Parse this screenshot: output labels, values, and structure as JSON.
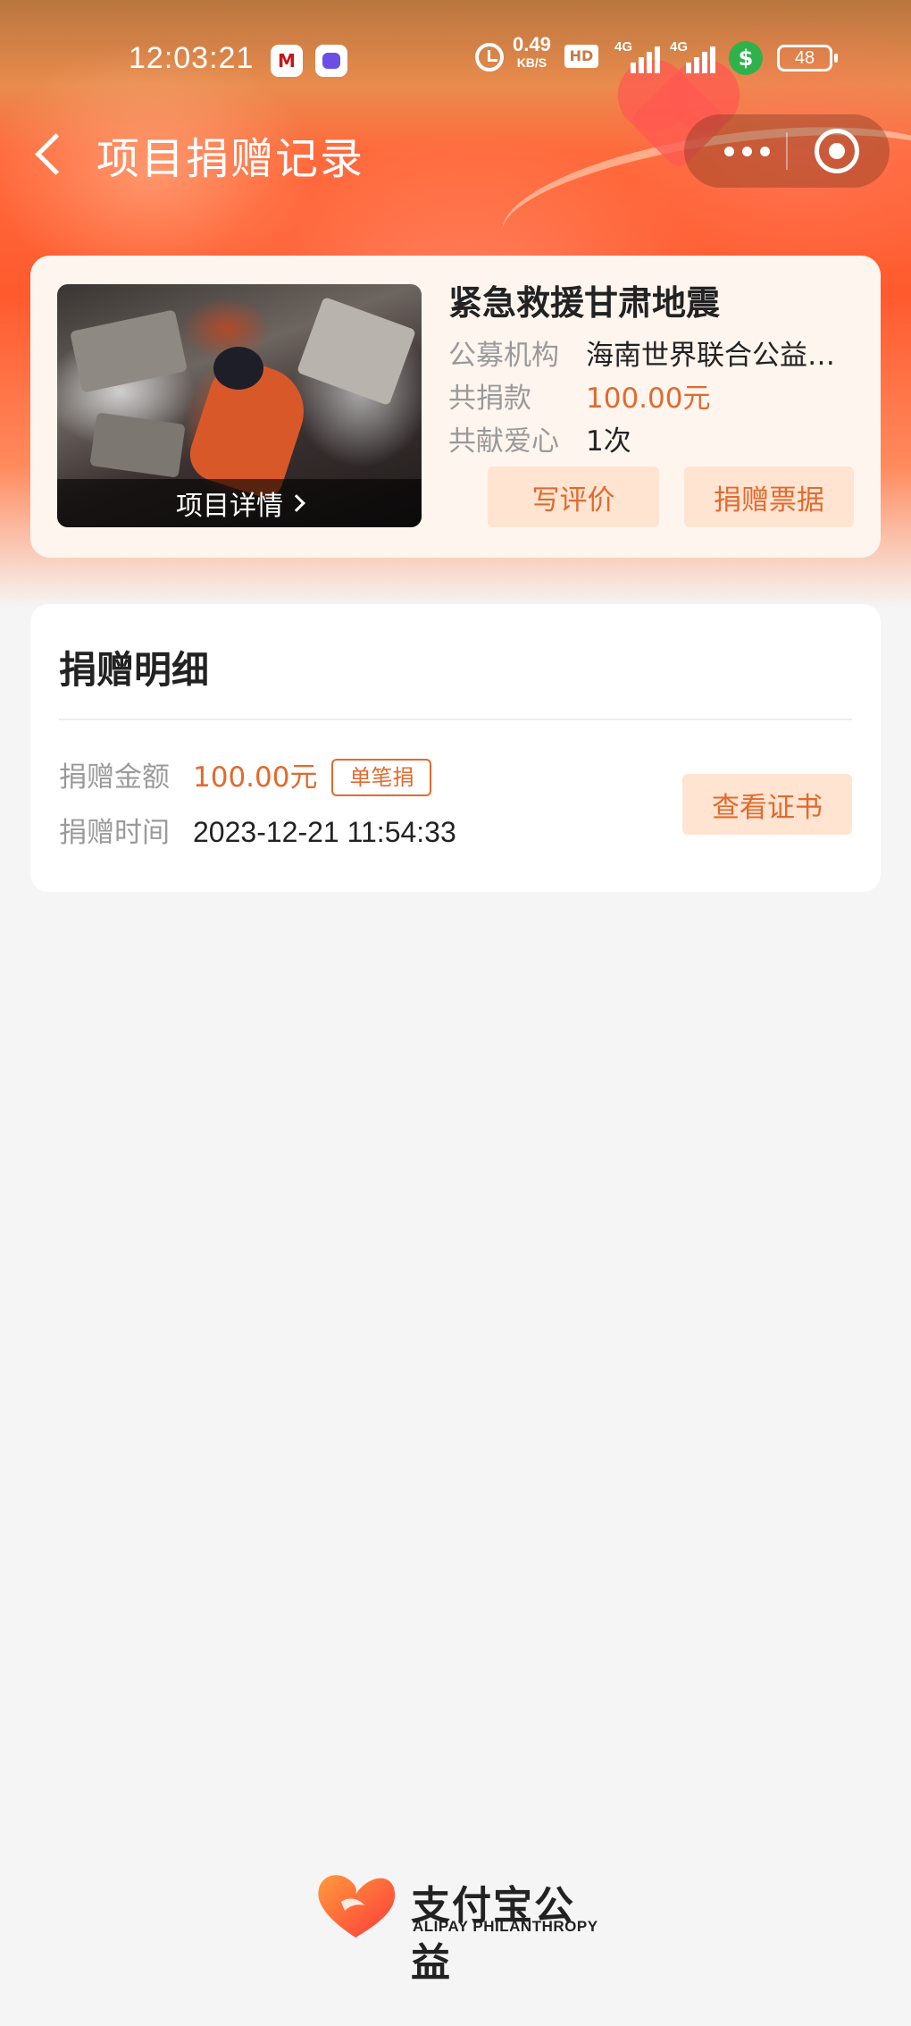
{
  "status_bar": {
    "time": "12:03:21",
    "cmb_icon": "M",
    "net_speed_value": "0.49",
    "net_speed_unit": "KB/S",
    "hd_label": "HD",
    "signal_1": "4G",
    "signal_2": "4G",
    "pay_icon": "$",
    "battery": "48"
  },
  "nav": {
    "title": "项目捐赠记录"
  },
  "project": {
    "title": "紧急救援甘肃地震",
    "image_caption": "项目详情",
    "org_label": "公募机构",
    "org_value": "海南世界联合公益…",
    "total_label": "共捐款",
    "total_value": "100.00元",
    "count_label": "共献爱心",
    "count_value": "1次",
    "review_button": "写评价",
    "receipt_button": "捐赠票据"
  },
  "detail": {
    "title": "捐赠明细",
    "amount_label": "捐赠金额",
    "amount_value": "100.00元",
    "tag": "单笔捐",
    "time_label": "捐赠时间",
    "time_value": "2023-12-21 11:54:33",
    "certificate_button": "查看证书"
  },
  "footer": {
    "brand_name": "支付宝公益",
    "brand_subtitle": "ALIPAY PHILANTHROPY"
  },
  "colors": {
    "accent": "#e16a2d",
    "button_bg": "#ffe4d2",
    "page_bg": "#f5f5f5"
  }
}
